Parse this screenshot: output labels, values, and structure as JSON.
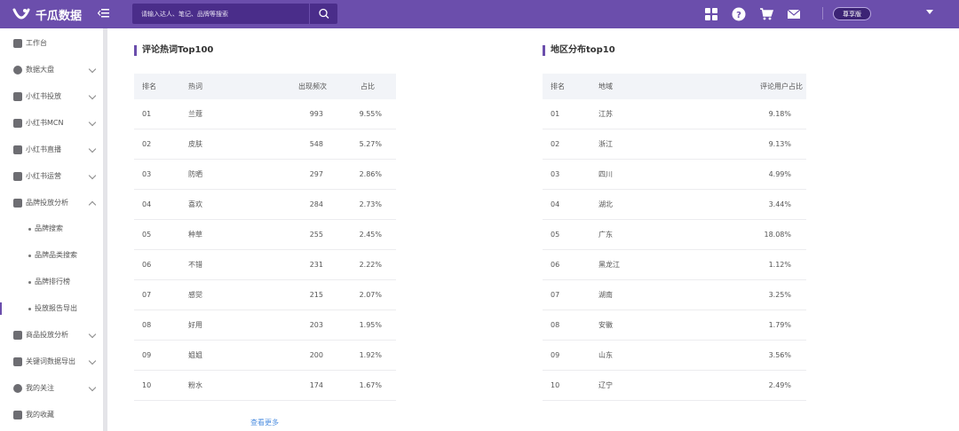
{
  "header": {
    "logo_text": "千瓜数据",
    "search_placeholder": "请输入达人、笔记、品牌等搜索",
    "version_badge": "尊享版"
  },
  "sidebar": {
    "items": [
      {
        "label": "工作台",
        "icon": "grid-icon",
        "chevron": "none"
      },
      {
        "label": "数据大盘",
        "icon": "pie-chart-icon",
        "chevron": "down"
      },
      {
        "label": "小红书投放",
        "icon": "cube-icon",
        "chevron": "down"
      },
      {
        "label": "小红书MCN",
        "icon": "building-icon",
        "chevron": "down"
      },
      {
        "label": "小红书直播",
        "icon": "video-icon",
        "chevron": "down"
      },
      {
        "label": "小红书运营",
        "icon": "calendar-icon",
        "chevron": "down"
      },
      {
        "label": "品牌投放分析",
        "icon": "trend-chart-icon",
        "chevron": "up"
      }
    ],
    "sub_items": [
      {
        "label": "品牌搜索"
      },
      {
        "label": "品牌品类搜索"
      },
      {
        "label": "品牌排行榜"
      },
      {
        "label": "投放报告导出"
      }
    ],
    "items_bottom": [
      {
        "label": "商品投放分析",
        "icon": "folder-icon",
        "chevron": "down"
      },
      {
        "label": "关键词数据导出",
        "icon": "export-icon",
        "chevron": "down"
      },
      {
        "label": "我的关注",
        "icon": "eye-icon",
        "chevron": "down"
      },
      {
        "label": "我的收藏",
        "icon": "archive-icon",
        "chevron": "none"
      }
    ]
  },
  "hot_words": {
    "title": "评论热词Top100",
    "columns": [
      "排名",
      "热词",
      "出现频次",
      "占比"
    ],
    "rows": [
      {
        "rank": "01",
        "word": "兰蔻",
        "count": "993",
        "ratio": "9.55%"
      },
      {
        "rank": "02",
        "word": "皮肤",
        "count": "548",
        "ratio": "5.27%"
      },
      {
        "rank": "03",
        "word": "防晒",
        "count": "297",
        "ratio": "2.86%"
      },
      {
        "rank": "04",
        "word": "喜欢",
        "count": "284",
        "ratio": "2.73%"
      },
      {
        "rank": "05",
        "word": "种草",
        "count": "255",
        "ratio": "2.45%"
      },
      {
        "rank": "06",
        "word": "不错",
        "count": "231",
        "ratio": "2.22%"
      },
      {
        "rank": "07",
        "word": "感觉",
        "count": "215",
        "ratio": "2.07%"
      },
      {
        "rank": "08",
        "word": "好用",
        "count": "203",
        "ratio": "1.95%"
      },
      {
        "rank": "09",
        "word": "姐姐",
        "count": "200",
        "ratio": "1.92%"
      },
      {
        "rank": "10",
        "word": "粉水",
        "count": "174",
        "ratio": "1.67%"
      }
    ],
    "more_link": "查看更多"
  },
  "regions": {
    "title": "地区分布top10",
    "columns": [
      "排名",
      "地域",
      "评论用户占比"
    ],
    "rows": [
      {
        "rank": "01",
        "region": "江苏",
        "ratio": "9.18%"
      },
      {
        "rank": "02",
        "region": "浙江",
        "ratio": "9.13%"
      },
      {
        "rank": "03",
        "region": "四川",
        "ratio": "4.99%"
      },
      {
        "rank": "04",
        "region": "湖北",
        "ratio": "3.44%"
      },
      {
        "rank": "05",
        "region": "广东",
        "ratio": "18.08%"
      },
      {
        "rank": "06",
        "region": "黑龙江",
        "ratio": "1.12%"
      },
      {
        "rank": "07",
        "region": "湖南",
        "ratio": "3.25%"
      },
      {
        "rank": "08",
        "region": "安徽",
        "ratio": "1.79%"
      },
      {
        "rank": "09",
        "region": "山东",
        "ratio": "3.56%"
      },
      {
        "rank": "10",
        "region": "辽宁",
        "ratio": "2.49%"
      }
    ]
  },
  "colors": {
    "brand": "#6b4eac",
    "link": "#4f8fe0"
  }
}
